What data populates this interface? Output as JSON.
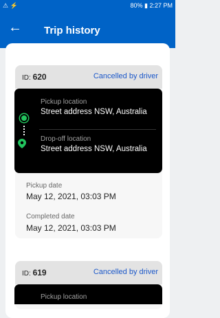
{
  "statusbar": {
    "left_icons": "⚠ ⚡",
    "right": "80% ▮ 2:27 PM"
  },
  "header": {
    "back_glyph": "←",
    "title": "Trip history"
  },
  "trips": [
    {
      "id_prefix": "ID:",
      "id": "620",
      "status": "Cancelled by driver",
      "pickup_label": "Pickup location",
      "pickup_address": "Street address NSW, Australia",
      "dropoff_label": "Drop-off location",
      "dropoff_address": "Street address NSW, Australia",
      "pickup_date_label": "Pickup date",
      "pickup_date": "May 12, 2021, 03:03 PM",
      "completed_date_label": "Completed date",
      "completed_date": "May 12, 2021, 03:03 PM"
    },
    {
      "id_prefix": "ID:",
      "id": "619",
      "status": "Cancelled by driver",
      "pickup_label": "Pickup location"
    }
  ],
  "colors": {
    "primary": "#0063c7",
    "status_text": "#1a57c9",
    "route_dot": "#22c55e"
  }
}
